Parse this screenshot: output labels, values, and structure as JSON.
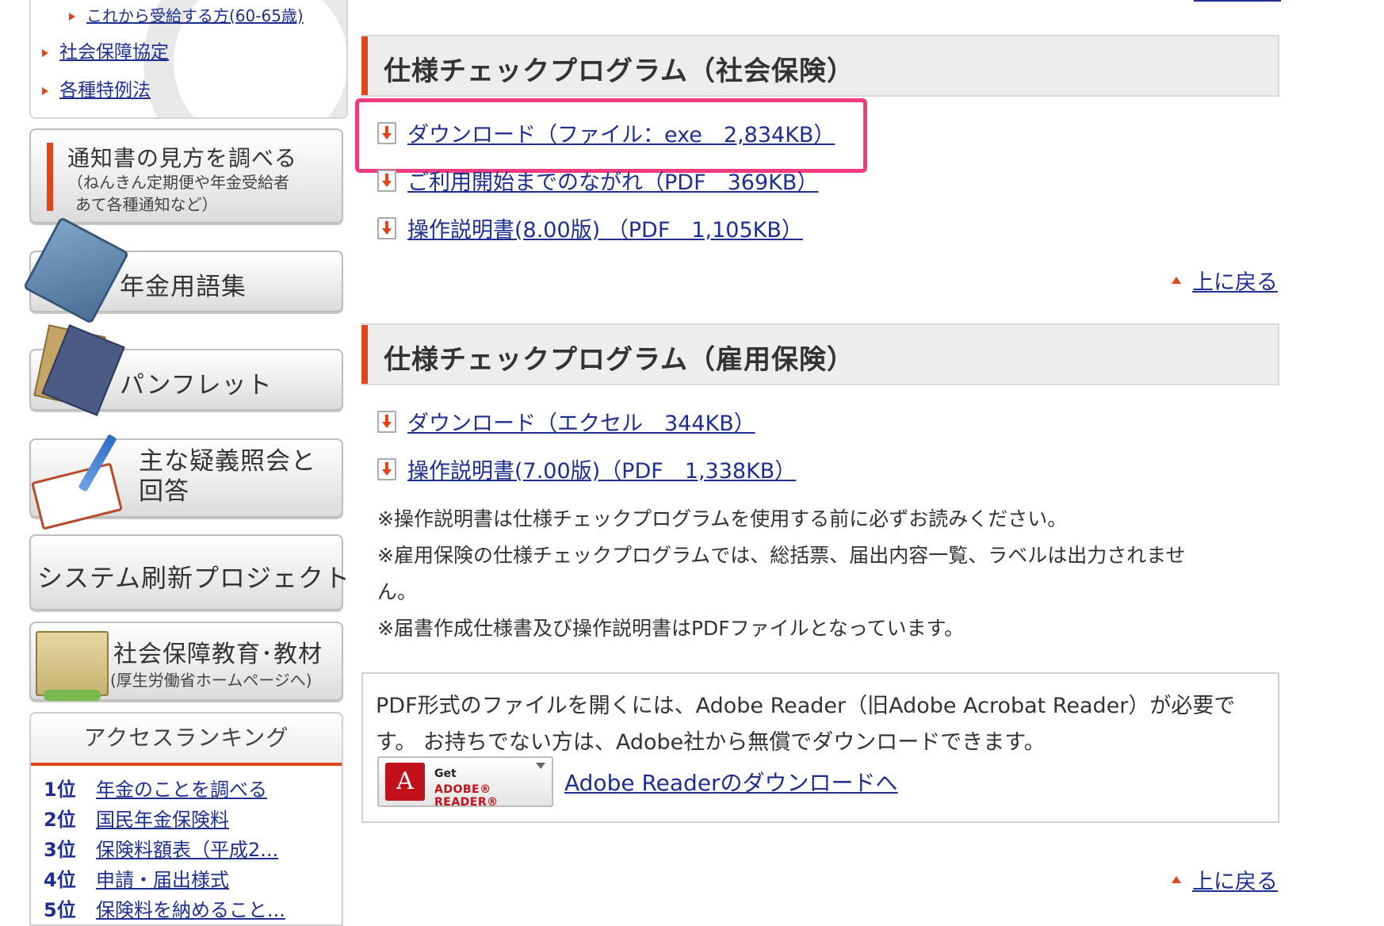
{
  "sidebar": {
    "top_links": {
      "sub_item": "これから受給する方(60-65歳)",
      "item1": "社会保障協定",
      "item2": "各種特例法"
    },
    "notice_button": {
      "title": "通知書の見方を調べる",
      "sub_line1": "（ねんきん定期便や年金受給者",
      "sub_line2": "あて各種通知など）"
    },
    "glossary_button": "年金用語集",
    "pamphlet_button": "パンフレット",
    "qa_button": {
      "line1": "主な疑義照会と",
      "line2": "回答"
    },
    "system_button": "システム刷新プロジェクト",
    "edu_button": {
      "title": "社会保障教育･教材",
      "sub": "(厚生労働省ホームページへ)"
    },
    "ranking": {
      "title": "アクセスランキング",
      "items": [
        {
          "rank": "1位",
          "label": "年金のことを調べる"
        },
        {
          "rank": "2位",
          "label": "国民年金保険料"
        },
        {
          "rank": "3位",
          "label": "保険料額表（平成2..."
        },
        {
          "rank": "4位",
          "label": "申請・届出様式"
        },
        {
          "rank": "5位",
          "label": "保険料を納めること..."
        }
      ]
    }
  },
  "main": {
    "section1": {
      "title": "仕様チェックプログラム（社会保険）",
      "links": [
        "ダウンロード（ファイル：exe　2,834KB）",
        "ご利用開始までのながれ（PDF　369KB）",
        "操作説明書(8.00版) （PDF　1,105KB）"
      ]
    },
    "back_to_top": "上に戻る",
    "section2": {
      "title": "仕様チェックプログラム（雇用保険）",
      "links": [
        "ダウンロード（エクセル　344KB）",
        "操作説明書(7.00版)（PDF　1,338KB）"
      ]
    },
    "notes": [
      "※操作説明書は仕様チェックプログラムを使用する前に必ずお読みください。",
      "※雇用保険の仕様チェックプログラムでは、総括票、届出内容一覧、ラベルは出力されませ",
      "ん。",
      "※届書作成仕様書及び操作説明書はPDFファイルとなっています。"
    ],
    "pdf_notice": {
      "line1": "PDF形式のファイルを開くには、Adobe Reader（旧Adobe Acrobat Reader）が必要で",
      "line2": "す。 お持ちでない方は、Adobe社から無償でダウンロードできます。",
      "badge_get": "Get",
      "badge_name": "ADOBE® READER®",
      "link": "Adobe Readerのダウンロードへ"
    }
  },
  "colors": {
    "accent": "#e0461a",
    "link": "#1f2f8f",
    "highlight": "#ef3b7d"
  }
}
